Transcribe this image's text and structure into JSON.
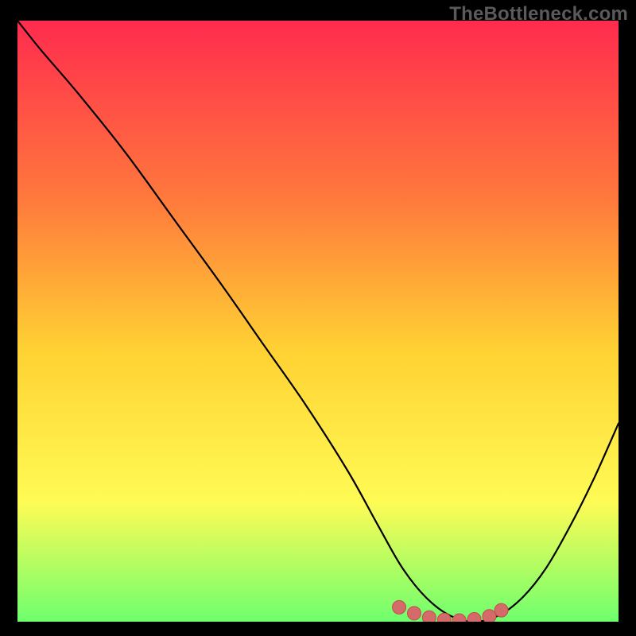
{
  "watermark": "TheBottleneck.com",
  "colors": {
    "bg": "#000000",
    "gradient_top": "#ff2b4e",
    "gradient_mid_upper": "#ff7a3c",
    "gradient_mid": "#ffd233",
    "gradient_mid_lower": "#fffb55",
    "gradient_bottom": "#6eff6e",
    "curve": "#000000",
    "dot_fill": "#d46a6a",
    "dot_stroke": "#c24d4d"
  },
  "chart_data": {
    "type": "line",
    "title": "",
    "xlabel": "",
    "ylabel": "",
    "xlim": [
      0,
      100
    ],
    "ylim": [
      0,
      100
    ],
    "grid": false,
    "legend": false,
    "series": [
      {
        "name": "bottleneck-curve",
        "x": [
          0,
          4,
          10,
          18,
          26,
          34,
          41,
          48,
          55,
          60,
          64,
          68,
          72,
          76,
          80,
          84,
          88,
          92,
          96,
          100
        ],
        "y": [
          100,
          95,
          88,
          78,
          67,
          56,
          46,
          36,
          25,
          16,
          9,
          4,
          1,
          0,
          1,
          4,
          9,
          16,
          24,
          33
        ]
      }
    ],
    "markers": {
      "name": "optimal-range",
      "x": [
        63.5,
        66,
        68.5,
        71,
        73.5,
        76,
        78.5,
        80.5
      ],
      "y": [
        2.4,
        1.4,
        0.7,
        0.3,
        0.2,
        0.4,
        0.9,
        1.9
      ]
    }
  }
}
